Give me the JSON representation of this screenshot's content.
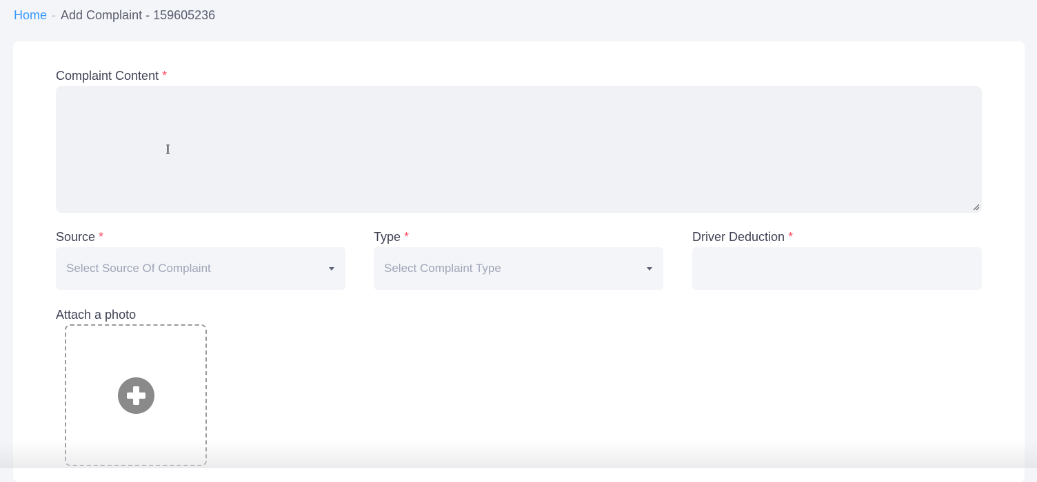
{
  "breadcrumb": {
    "home": "Home",
    "separator": "-",
    "current": "Add Complaint - 159605236"
  },
  "form": {
    "complaint_content": {
      "label": "Complaint Content",
      "required_mark": "*",
      "value": ""
    },
    "source": {
      "label": "Source",
      "required_mark": "*",
      "placeholder": "Select Source Of Complaint"
    },
    "type": {
      "label": "Type",
      "required_mark": "*",
      "placeholder": "Select Complaint Type"
    },
    "driver_deduction": {
      "label": "Driver Deduction",
      "required_mark": "*",
      "value": ""
    },
    "photo": {
      "label": "Attach a photo",
      "icon": "plus-circle-icon"
    }
  },
  "colors": {
    "link": "#3699ff",
    "required": "#f64e60",
    "field_bg": "#f3f5f8",
    "placeholder": "#a1a5b7"
  }
}
